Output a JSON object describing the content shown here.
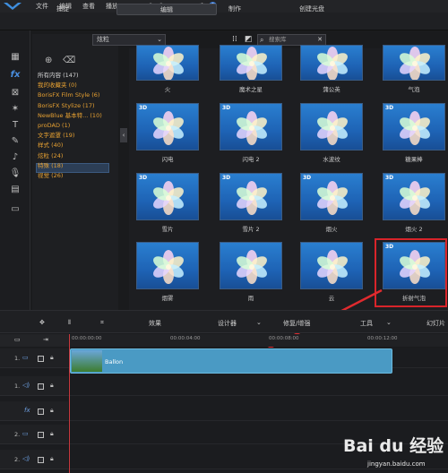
{
  "menu": {
    "items": [
      "文件",
      "编辑",
      "查看",
      "播放"
    ]
  },
  "tabs": [
    {
      "label": "捕捉"
    },
    {
      "label": "编辑",
      "active": true
    },
    {
      "label": "制作"
    },
    {
      "label": "创建光盘"
    }
  ],
  "toolbar": {
    "category_dropdown": "炫粒",
    "search_placeholder": "搜索库"
  },
  "categories": [
    {
      "label": "所有内容 (147)",
      "color": "white"
    },
    {
      "label": "我的收藏夹 (0)",
      "color": "orange"
    },
    {
      "label": "BorisFX Film Style (6)",
      "color": "orange"
    },
    {
      "label": "BorisFX Stylize (17)",
      "color": "orange"
    },
    {
      "label": "NewBlue 基本特... (10)",
      "color": "orange"
    },
    {
      "label": "proDAD (1)",
      "color": "orange"
    },
    {
      "label": "文字遮罩 (19)",
      "color": "orange"
    },
    {
      "label": "样式 (40)",
      "color": "orange"
    },
    {
      "label": "炫粒 (24)",
      "color": "orange",
      "selected": true
    },
    {
      "label": "特殊 (18)",
      "color": "orange"
    },
    {
      "label": "视觉 (26)",
      "color": "orange"
    }
  ],
  "effects": [
    {
      "label": "火",
      "badge": ""
    },
    {
      "label": "魔术之星",
      "badge": ""
    },
    {
      "label": "蒲公英",
      "badge": ""
    },
    {
      "label": "气泡",
      "badge": ""
    },
    {
      "label": "闪电",
      "badge": "3D"
    },
    {
      "label": "闪电 2",
      "badge": "3D"
    },
    {
      "label": "水波纹",
      "badge": ""
    },
    {
      "label": "糖果棒",
      "badge": "3D"
    },
    {
      "label": "雪片",
      "badge": "3D"
    },
    {
      "label": "雪片 2",
      "badge": "3D"
    },
    {
      "label": "烟火",
      "badge": "3D"
    },
    {
      "label": "烟火 2",
      "badge": "3D"
    },
    {
      "label": "烟雾",
      "badge": ""
    },
    {
      "label": "雨",
      "badge": ""
    },
    {
      "label": "云",
      "badge": ""
    },
    {
      "label": "折射气泡",
      "badge": "3D"
    }
  ],
  "timeline_toolbar": {
    "effects": "效果",
    "designer": "设计器",
    "fix": "修复/增强",
    "tools": "工具",
    "slideshow": "幻灯片"
  },
  "ruler": {
    "t0": "00:00:00:00",
    "t1": "00:00:04:00",
    "t2": "00:00:08:00",
    "t3": "00:00:12:00"
  },
  "tracks": [
    {
      "number": "1."
    },
    {
      "number": "1."
    },
    {
      "number": ""
    },
    {
      "number": "2."
    },
    {
      "number": "2."
    }
  ],
  "clip": {
    "label": "Ballon"
  },
  "watermark": {
    "text": "Bai du 经验",
    "url": "jingyan.baidu.com"
  },
  "colors": {
    "accent": "#4a8fe0",
    "highlight": "#d8242a",
    "category_orange": "#e7a132"
  }
}
